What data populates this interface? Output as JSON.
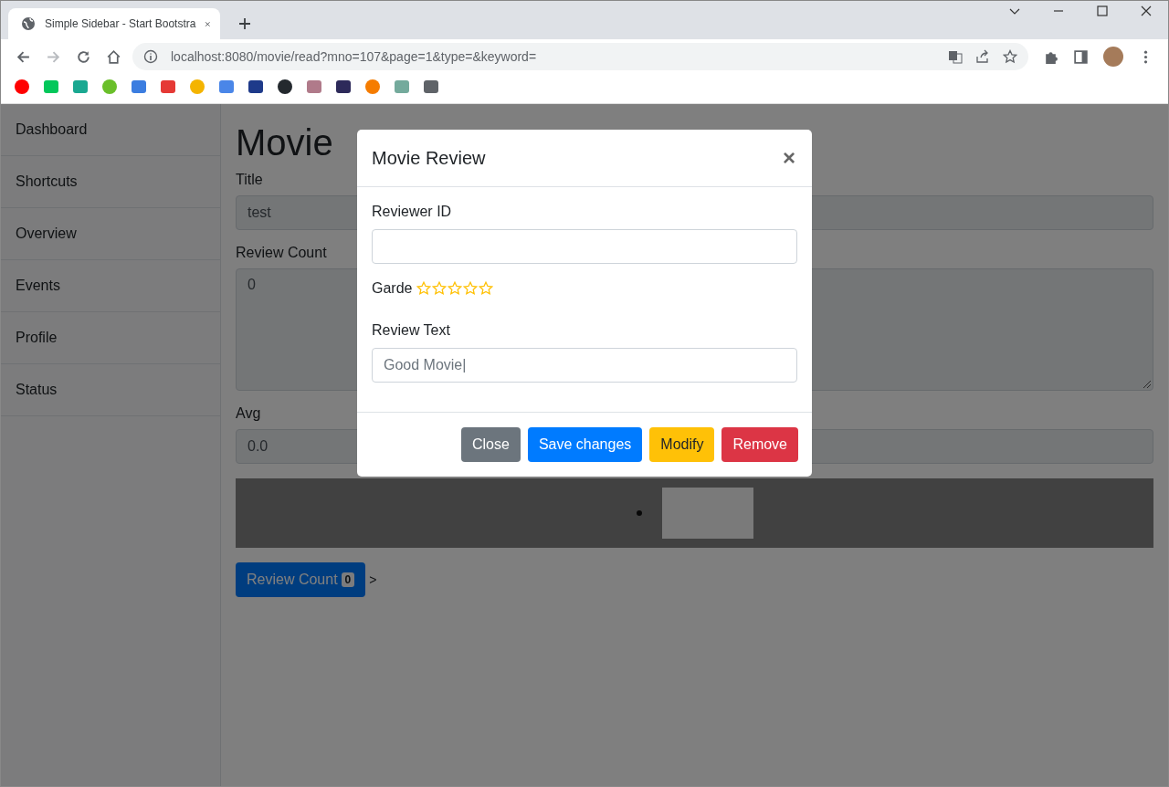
{
  "browser": {
    "tab_title": "Simple Sidebar - Start Bootstra",
    "url": "localhost:8080/movie/read?mno=107&page=1&type=&keyword=",
    "bookmarks": [
      {
        "color": "#ff0000"
      },
      {
        "color": "#03c75a"
      },
      {
        "color": "#1aa891"
      },
      {
        "color": "#6abf2a"
      },
      {
        "color": "#3b7de0"
      },
      {
        "color": "#e53935"
      },
      {
        "color": "#f4b400"
      },
      {
        "color": "#4a86e8"
      },
      {
        "color": "#1e3a8a"
      },
      {
        "color": "#24292e"
      },
      {
        "color": "#b07a8a"
      },
      {
        "color": "#2d2a5a"
      },
      {
        "color": "#f57c00"
      },
      {
        "color": "#74aa9c"
      },
      {
        "color": "#5f6368"
      }
    ]
  },
  "sidebar": {
    "items": [
      {
        "label": "Dashboard"
      },
      {
        "label": "Shortcuts"
      },
      {
        "label": "Overview"
      },
      {
        "label": "Events"
      },
      {
        "label": "Profile"
      },
      {
        "label": "Status"
      }
    ]
  },
  "page": {
    "heading": "Movie",
    "fields": [
      {
        "label": "Title",
        "kind": "input",
        "value": "test"
      },
      {
        "label": "Review Count",
        "kind": "textarea",
        "value": "0"
      },
      {
        "label": "Avg",
        "kind": "input",
        "value": "0.0"
      }
    ],
    "review_count_button": {
      "label": "Review Count",
      "badge": "0"
    },
    "trailing_text": ">"
  },
  "modal": {
    "title": "Movie Review",
    "close_symbol": "×",
    "reviewer_label": "Reviewer ID",
    "grade_label": "Garde",
    "stars": 0,
    "review_label": "Review Text",
    "review_value": "Good Movie|",
    "buttons": [
      {
        "label": "Close",
        "kind": "secondary"
      },
      {
        "label": "Save changes",
        "kind": "primary"
      },
      {
        "label": "Modify",
        "kind": "warning"
      },
      {
        "label": "Remove",
        "kind": "danger"
      }
    ]
  }
}
